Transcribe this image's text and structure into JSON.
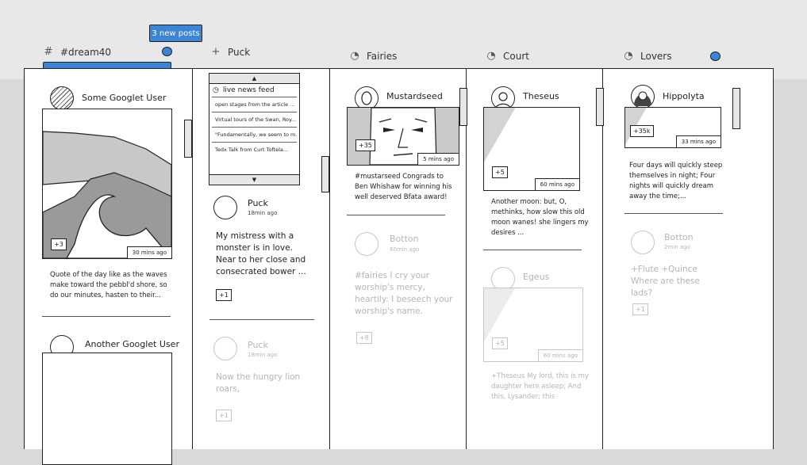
{
  "new_posts_label": "3 new posts",
  "columns": [
    {
      "icon": "hash-icon",
      "symbol": "#",
      "title": "#dream40"
    },
    {
      "icon": "plus-icon",
      "symbol": "+",
      "title": "Puck"
    },
    {
      "icon": "spinner-icon",
      "symbol": "◔",
      "title": "Fairies"
    },
    {
      "icon": "spinner-icon",
      "symbol": "◔",
      "title": "Court"
    },
    {
      "icon": "spinner-icon",
      "symbol": "◔",
      "title": "Lovers"
    }
  ],
  "col1": {
    "post1": {
      "author": "Some Googlet User",
      "badge": "+3",
      "time": "30 mins ago",
      "text": "Quote of the day like as the waves make toward the pebbl'd shore, so do our minutes, hasten to their..."
    },
    "post2": {
      "author": "Another Googlet User"
    }
  },
  "col2": {
    "feed": {
      "title": "live news feed",
      "items": [
        "open stages from the article ...",
        "Virtual tours of the Swan, Roy...",
        "\"Fundamentally, we seem to m...",
        "Tedx Talk from Curt Toftela..."
      ]
    },
    "post1": {
      "author": "Puck",
      "time": "18min ago",
      "text": "My mistress with a monster is in love. Near to her close and consecrated bower ...",
      "badge": "+1"
    },
    "post2": {
      "author": "Puck",
      "time": "18min ago",
      "text": "Now the hungry lion roars,",
      "badge": "+1"
    }
  },
  "col3": {
    "post1": {
      "author": "Mustardseed",
      "badge": "+35",
      "time": "5 mins ago",
      "text": "#mustarseed Congrads to Ben Whishaw for winning his well deserved Bfata award!"
    },
    "post2": {
      "author": "Botton",
      "time": "60min ago",
      "text": "#fairies I cry your worship's mercy, heartily: I beseech your worship's name.",
      "badge": "+8"
    }
  },
  "col4": {
    "post1": {
      "author": "Theseus",
      "badge": "+5",
      "time": "60 mins ago",
      "text": "Another moon: but, O, methinks, how slow this old moon wanes! she lingers my desires ..."
    },
    "post2": {
      "author": "Egeus",
      "badge": "+5",
      "time": "60 mins ago",
      "text": "+Theseus My lord, this is my daughter here asleep; And this, Lysander; this"
    }
  },
  "col5": {
    "post1": {
      "author": "Hippolyta",
      "badge": "+35k",
      "time": "33 mins ago",
      "text": "Four days will quickly steep themselves in night; Four nights will quickly dream away the time;..."
    },
    "post2": {
      "author": "Botton",
      "time": "2min ago",
      "text": "+Flute +Quince Where are these lads?",
      "badge": "+1"
    }
  }
}
